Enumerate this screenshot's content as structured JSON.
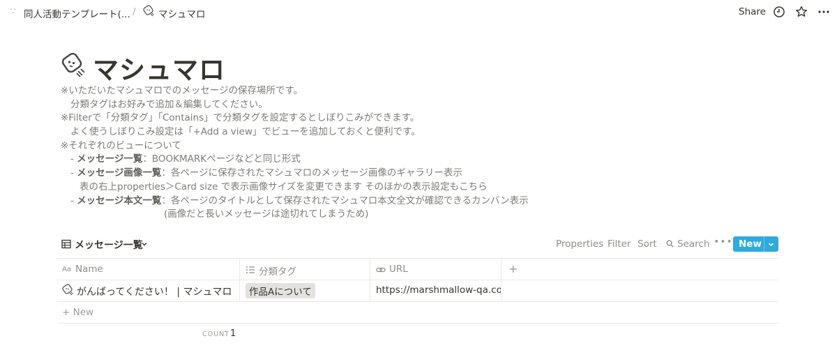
{
  "topbar": {
    "breadcrumb_parent": "同人活動テンプレート(...",
    "breadcrumb_separator": "/",
    "breadcrumb_current": "マシュマロ",
    "share_label": "Share"
  },
  "page": {
    "title": "マシュマロ",
    "description": {
      "line1": "※いただいたマシュマロでのメッセージの保存場所です。",
      "line2": "分類タグはお好みで追加＆編集してください。",
      "line3": "※Filterで「分類タグ」「Contains」で分類タグを設定するとしぼりこみができます。",
      "line4": "よく使うしぼりこみ設定は「+Add a view」でビューを追加しておくと便利です。",
      "line5": "※それぞれのビューについて",
      "line6_prefix": "- ",
      "line6_bold": "メッセージ一覧",
      "line6_rest": "：BOOKMARKページなどと同じ形式",
      "line7_prefix": "- ",
      "line7_bold": "メッセージ画像一覧",
      "line7_rest": "：各ページに保存されたマシュマロのメッセージ画像のギャラリー表示",
      "line8": "表の右上properties＞Card size で表示画像サイズを変更できます そのほかの表示設定もこちら",
      "line9_prefix": "- ",
      "line9_bold": "メッセージ本文一覧",
      "line9_rest": "：各ページのタイトルとして保存されたマシュマロ本文全文が確認できるカンバン表示",
      "line10": "(画像だと長いメッセージは途切れてしまうため)"
    }
  },
  "database": {
    "view_name": "メッセージ一覧",
    "toolbar": {
      "properties": "Properties",
      "filter": "Filter",
      "sort": "Sort",
      "search": "Search",
      "new_button": "New"
    },
    "columns": [
      {
        "label": "Name",
        "icon": "title-aa-icon"
      },
      {
        "label": "分類タグ",
        "icon": "list-icon"
      },
      {
        "label": "URL",
        "icon": "link-icon"
      }
    ],
    "rows": [
      {
        "name": "がんばってください！ | マシュマロ",
        "tag": "作品Aについて",
        "url": "https://marshmallow-qa.com/m"
      }
    ],
    "add_new_label": "New",
    "count_label": "COUNT",
    "count_value": "1"
  },
  "colors": {
    "accent_button": "#2eaadc",
    "text_primary": "#37352f",
    "text_muted": "#7d7c78",
    "tag_bg": "#e3e2e0"
  }
}
